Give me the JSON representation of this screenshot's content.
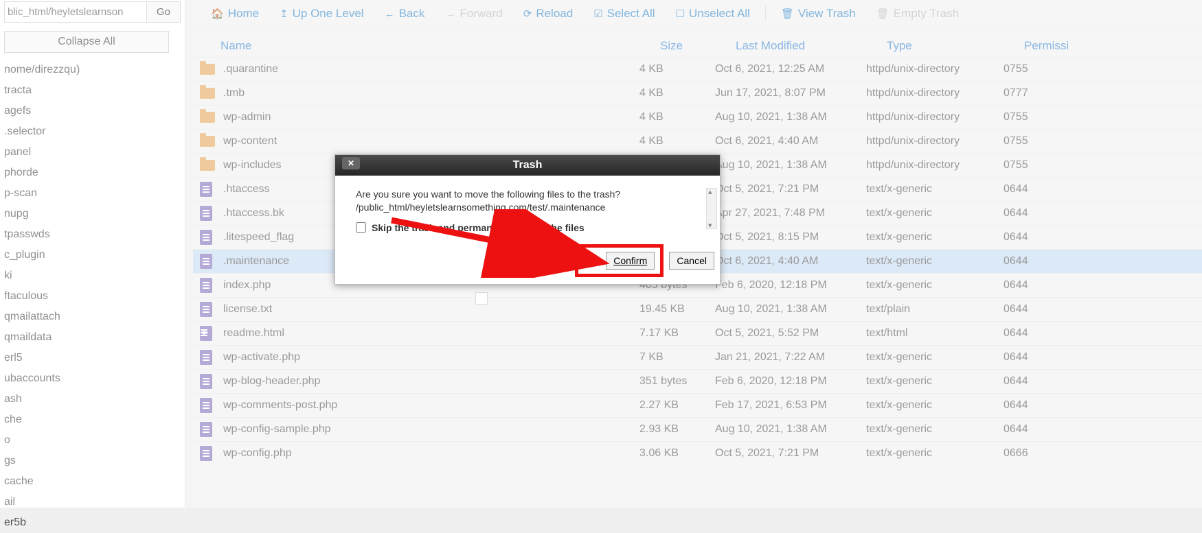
{
  "path_input": "blic_html/heyletslearnson",
  "go_label": "Go",
  "collapse_label": "Collapse All",
  "tree_items": [
    "nome/direzzqu)",
    "tracta",
    "agefs",
    ".selector",
    "panel",
    "phorde",
    "p-scan",
    "nupg",
    "tpasswds",
    "c_plugin",
    "ki",
    "ftaculous",
    "qmailattach",
    "qmaildata",
    "erl5",
    "ubaccounts",
    "ash",
    "che",
    "o",
    "gs",
    "cache",
    "ail",
    "er5b"
  ],
  "toolbar": {
    "home": "Home",
    "up": "Up One Level",
    "back": "Back",
    "forward": "Forward",
    "reload": "Reload",
    "select_all": "Select All",
    "unselect_all": "Unselect All",
    "view_trash": "View Trash",
    "empty_trash": "Empty Trash"
  },
  "columns": {
    "name": "Name",
    "size": "Size",
    "mod": "Last Modified",
    "type": "Type",
    "perm": "Permissi"
  },
  "files": [
    {
      "icon": "folder",
      "name": ".quarantine",
      "size": "4 KB",
      "mod": "Oct 6, 2021, 12:25 AM",
      "type": "httpd/unix-directory",
      "perm": "0755"
    },
    {
      "icon": "folder",
      "name": ".tmb",
      "size": "4 KB",
      "mod": "Jun 17, 2021, 8:07 PM",
      "type": "httpd/unix-directory",
      "perm": "0777"
    },
    {
      "icon": "folder",
      "name": "wp-admin",
      "size": "4 KB",
      "mod": "Aug 10, 2021, 1:38 AM",
      "type": "httpd/unix-directory",
      "perm": "0755"
    },
    {
      "icon": "folder",
      "name": "wp-content",
      "size": "4 KB",
      "mod": "Oct 6, 2021, 4:40 AM",
      "type": "httpd/unix-directory",
      "perm": "0755"
    },
    {
      "icon": "folder",
      "name": "wp-includes",
      "size": "",
      "mod": "Aug 10, 2021, 1:38 AM",
      "type": "httpd/unix-directory",
      "perm": "0755"
    },
    {
      "icon": "file",
      "name": ".htaccess",
      "size": "",
      "mod": "Oct 5, 2021, 7:21 PM",
      "type": "text/x-generic",
      "perm": "0644"
    },
    {
      "icon": "file",
      "name": ".htaccess.bk",
      "size": "",
      "mod": "Apr 27, 2021, 7:48 PM",
      "type": "text/x-generic",
      "perm": "0644"
    },
    {
      "icon": "file",
      "name": ".litespeed_flag",
      "size": "",
      "mod": "Oct 5, 2021, 8:15 PM",
      "type": "text/x-generic",
      "perm": "0644"
    },
    {
      "icon": "file",
      "name": ".maintenance",
      "size": "",
      "mod": "Oct 6, 2021, 4:40 AM",
      "type": "text/x-generic",
      "perm": "0644",
      "selected": true
    },
    {
      "icon": "file",
      "name": "index.php",
      "size": "405 bytes",
      "mod": "Feb 6, 2020, 12:18 PM",
      "type": "text/x-generic",
      "perm": "0644"
    },
    {
      "icon": "file",
      "name": "license.txt",
      "size": "19.45 KB",
      "mod": "Aug 10, 2021, 1:38 AM",
      "type": "text/plain",
      "perm": "0644"
    },
    {
      "icon": "code",
      "name": "readme.html",
      "size": "7.17 KB",
      "mod": "Oct 5, 2021, 5:52 PM",
      "type": "text/html",
      "perm": "0644"
    },
    {
      "icon": "file",
      "name": "wp-activate.php",
      "size": "7 KB",
      "mod": "Jan 21, 2021, 7:22 AM",
      "type": "text/x-generic",
      "perm": "0644"
    },
    {
      "icon": "file",
      "name": "wp-blog-header.php",
      "size": "351 bytes",
      "mod": "Feb 6, 2020, 12:18 PM",
      "type": "text/x-generic",
      "perm": "0644"
    },
    {
      "icon": "file",
      "name": "wp-comments-post.php",
      "size": "2.27 KB",
      "mod": "Feb 17, 2021, 6:53 PM",
      "type": "text/x-generic",
      "perm": "0644"
    },
    {
      "icon": "file",
      "name": "wp-config-sample.php",
      "size": "2.93 KB",
      "mod": "Aug 10, 2021, 1:38 AM",
      "type": "text/x-generic",
      "perm": "0644"
    },
    {
      "icon": "file",
      "name": "wp-config.php",
      "size": "3.06 KB",
      "mod": "Oct 5, 2021, 7:21 PM",
      "type": "text/x-generic",
      "perm": "0666"
    }
  ],
  "dialog": {
    "title": "Trash",
    "line1": "Are you sure you want to move the following files to the trash?",
    "line2": "/public_html/heyletslearnsomething.com/test/.maintenance",
    "skip_label": "Skip the trash and permanently delete the files",
    "confirm": "Confirm",
    "cancel": "Cancel"
  }
}
